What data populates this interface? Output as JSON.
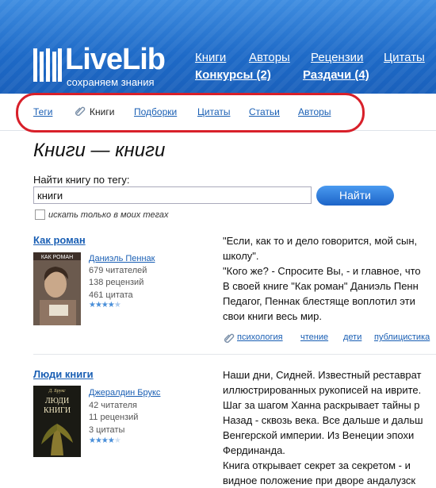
{
  "logo": {
    "word": "LiveLib",
    "tagline": "сохраняем знания"
  },
  "top_nav": [
    {
      "label": "Книги",
      "bold": false
    },
    {
      "label": "Авторы",
      "bold": false
    },
    {
      "label": "Рецензии",
      "bold": false
    },
    {
      "label": "Цитаты",
      "bold": false
    },
    {
      "label": "Конкурсы (2)",
      "bold": true
    },
    {
      "label": "Раздачи (4)",
      "bold": true
    }
  ],
  "sub_nav": {
    "items": [
      "Теги",
      "Книги",
      "Подборки",
      "Цитаты",
      "Статьи",
      "Авторы"
    ],
    "current": "Книги"
  },
  "page_title": "Книги — книги",
  "search": {
    "label": "Найти книгу по тегу:",
    "value": "книги",
    "button": "Найти",
    "checkbox_label": "искать только в моих тегах",
    "checkbox_checked": false
  },
  "books": [
    {
      "title": "Как роман",
      "cover_text": "КАК РОМАН",
      "author": "Даниэль Пеннак",
      "readers": "679 читателей",
      "reviews": "138 рецензий",
      "quotes": "461 цитата",
      "rating": 4.5,
      "description": [
        "\"Если, как то и дело говорится, мой сын,",
        "школу\".",
        "\"Кого же? - Спросите Вы, - и главное, что",
        "В своей книге \"Как роман\" Даниэль Пенн",
        "Педагог, Пеннак блестяще воплотил эти",
        "свои книги весь мир."
      ],
      "tags": [
        "психология",
        "чтение",
        "дети",
        "публицистика"
      ]
    },
    {
      "title": "Люди книги",
      "cover_text": "ЛЮДИ КНИГИ",
      "cover_author": "Д. Брукс",
      "author": "Джералдин Брукс",
      "readers": "42 читателя",
      "reviews": "11 рецензий",
      "quotes": "3 цитаты",
      "rating": 4,
      "description": [
        "Наши дни, Сидней. Известный реставрат",
        "иллюстрированных рукописей на иврите.",
        "Шаг за шагом Ханна раскрывает тайны р",
        "Назад - сквозь века. Все дальше и дальш",
        "Венгерской империи. Из Венеции эпохи",
        "Фердинанда.",
        "Книга открывает секрет за секретом - и",
        "видное положение при дворе андалузск"
      ],
      "tags": []
    }
  ],
  "colors": {
    "header": "#1e6ac7",
    "link": "#1a5fb4",
    "highlight": "#d8202a",
    "button": "#2f7fe0"
  }
}
